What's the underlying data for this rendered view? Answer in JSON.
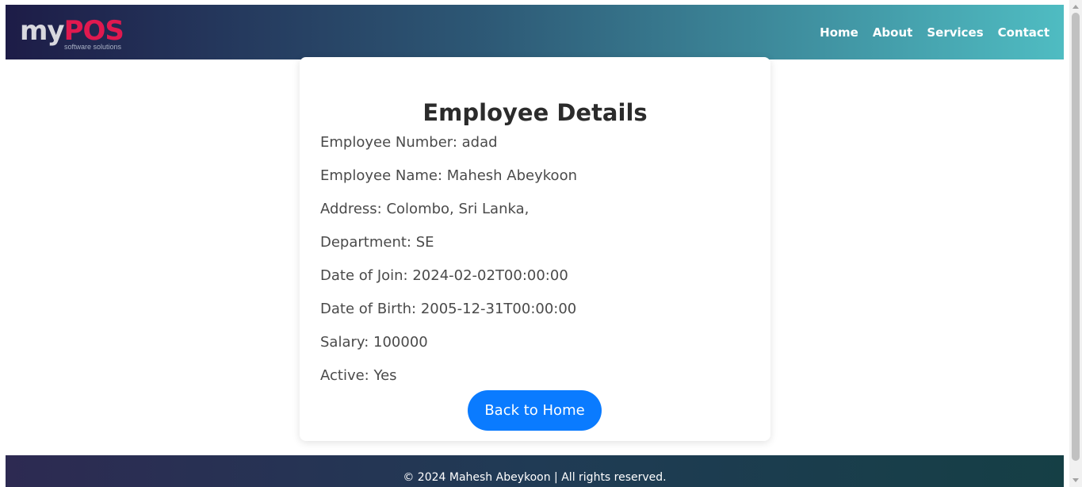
{
  "navbar": {
    "logo": {
      "my": "my",
      "pos": "POS",
      "tagline": "software solutions"
    },
    "links": [
      "Home",
      "About",
      "Services",
      "Contact"
    ]
  },
  "card": {
    "title": "Employee Details",
    "rows": [
      "Employee Number: adad",
      "Employee Name: Mahesh Abeykoon",
      "Address: Colombo, Sri Lanka,",
      "Department: SE",
      "Date of Join: 2024-02-02T00:00:00",
      "Date of Birth: 2005-12-31T00:00:00",
      "Salary: 100000",
      "Active: Yes"
    ],
    "back_button": "Back to Home"
  },
  "footer": {
    "text": "© 2024 Mahesh Abeykoon | All rights reserved."
  },
  "colors": {
    "brand_pink": "#e0194f",
    "button_blue": "#0a7bff",
    "nav_gradient_start": "#1d1c47",
    "nav_gradient_end": "#4fbcc2"
  }
}
